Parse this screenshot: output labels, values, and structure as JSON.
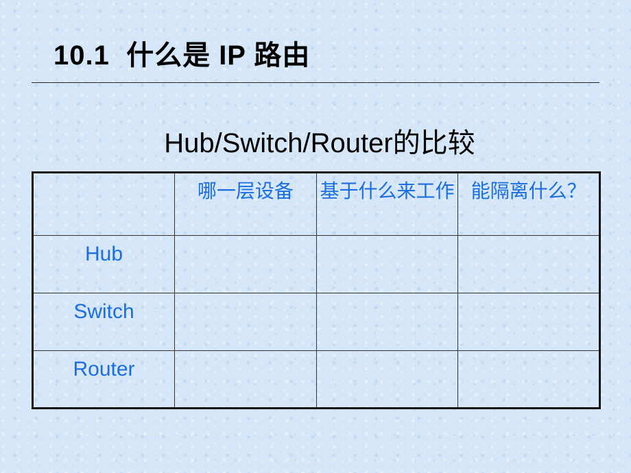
{
  "slide": {
    "title": "10.1  什么是 IP 路由",
    "subtitle": "Hub/Switch/Router的比较"
  },
  "table": {
    "headers": [
      "",
      "哪一层设备",
      "基于什么来工作",
      "能隔离什么？"
    ],
    "rows": [
      {
        "label": "Hub",
        "cells": [
          "",
          "",
          ""
        ]
      },
      {
        "label": "Switch",
        "cells": [
          "",
          "",
          ""
        ]
      },
      {
        "label": "Router",
        "cells": [
          "",
          "",
          ""
        ]
      }
    ]
  },
  "colors": {
    "background": "#d4e6f7",
    "table_text": "#1a6ee0",
    "title_text": "#000000"
  }
}
